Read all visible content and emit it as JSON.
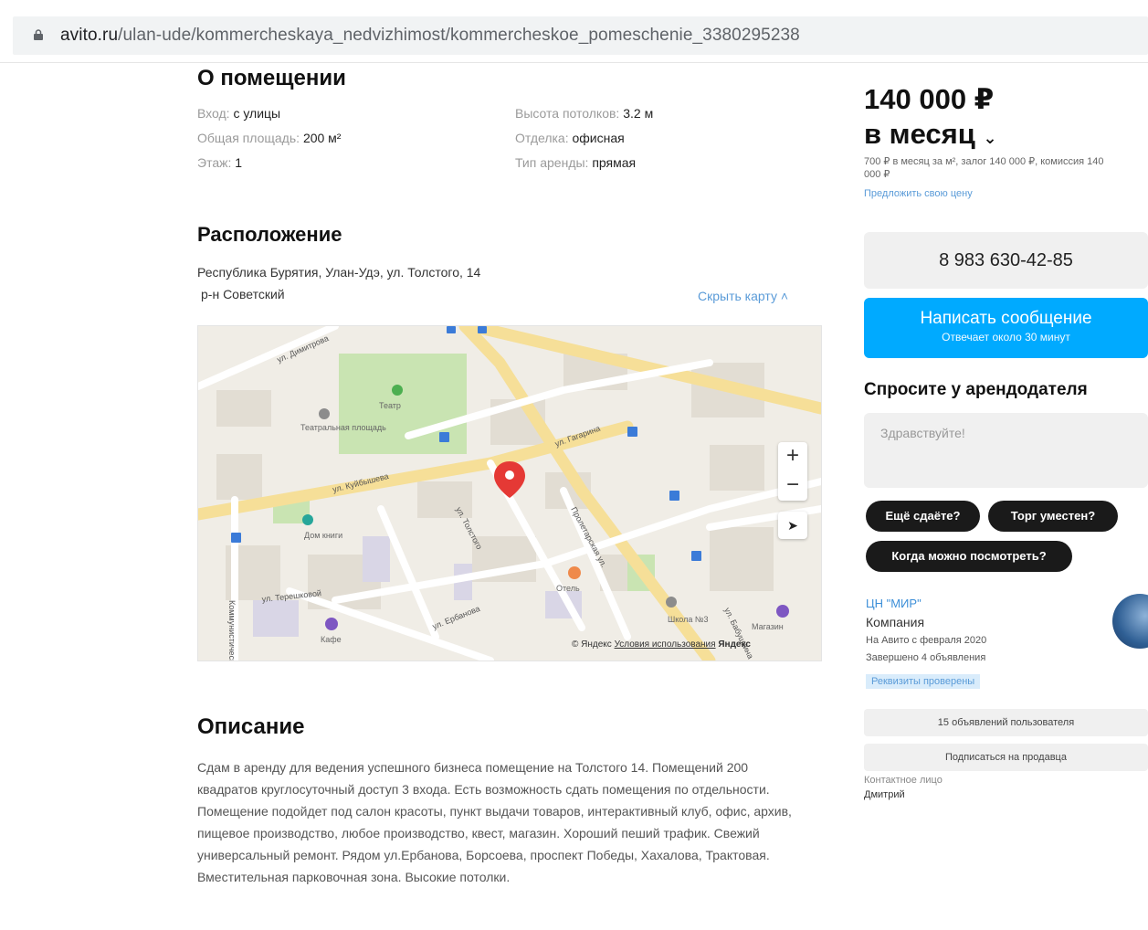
{
  "browser": {
    "url_host": "avito.ru",
    "url_path": "/ulan-ude/kommercheskaya_nedvizhimost/kommercheskoe_pomeschenie_3380295238"
  },
  "about": {
    "title": "О помещении",
    "props": [
      {
        "label": "Вход:",
        "value": "с улицы"
      },
      {
        "label": "Общая площадь:",
        "value": "200 м²"
      },
      {
        "label": "Этаж:",
        "value": "1"
      },
      {
        "label": "Высота потолков:",
        "value": "3.2 м"
      },
      {
        "label": "Отделка:",
        "value": "офисная"
      },
      {
        "label": "Тип аренды:",
        "value": "прямая"
      }
    ]
  },
  "location": {
    "title": "Расположение",
    "address": "Республика Бурятия, Улан-Удэ, ул. Толстого, 14",
    "district": "р-н Советский",
    "hide_map": "Скрыть карту",
    "map": {
      "streets": [
        "ул. Димитрова",
        "ул. Куйбышева",
        "ул. Толстого",
        "ул. Гагарина",
        "Пролетарская ул.",
        "ул. Ербанова",
        "ул. Терешковой",
        "Коммунистическая ул.",
        "ул. Бабушкина"
      ],
      "pois": [
        "Театр",
        "Театральная площадь",
        "Дом книги",
        "Отель",
        "Школа №3",
        "Магазин",
        "Кафе"
      ],
      "footer_brand": "© Яндекс",
      "footer_terms": "Условия использования",
      "footer_logo": "Яндекс",
      "zoom_in": "+",
      "zoom_out": "−",
      "locate": "➤"
    }
  },
  "description": {
    "title": "Описание",
    "text": "Сдам в аренду для ведения успешного бизнеса помещение на Толстого 14. Помещений 200 квадратов круглосуточный доступ 3 входа. Есть возможность сдать помещения по отдельности. Помещение подойдет под салон красоты, пункт выдачи товаров, интерактивный клуб, офис, архив, пищевое производство, любое производство, квест, магазин. Хороший пеший трафик. Свежий универсальный ремонт. Рядом ул.Ербанова, Борсоева, проспект Победы, Хахалова, Трактовая. Вместительная парковочная зона. Высокие потолки."
  },
  "sidebar": {
    "price": "140 000 ₽",
    "period": "в месяц",
    "price_note": "700 ₽ в месяц за м², залог 140 000 ₽, комиссия 140 000 ₽",
    "propose_link": "Предложить свою цену",
    "phone": "8 983 630-42-85",
    "message_btn": "Написать сообщение",
    "message_sub": "Отвечает около 30 минут",
    "ask_title": "Спросите у арендодателя",
    "ask_placeholder": "Здравствуйте!",
    "chips": [
      "Ещё сдаёте?",
      "Торг уместен?",
      "Когда можно посмотреть?"
    ],
    "seller": {
      "name": "ЦН \"МИР\"",
      "type": "Компания",
      "since": "На Авито с февраля 2020",
      "ads": "Завершено 4 объявления",
      "verified": "Реквизиты проверены"
    },
    "other_ads": "15 объявлений пользователя",
    "subscribe": "Подписаться на продавца",
    "contact_label": "Контактное лицо",
    "contact_name": "Дмитрий"
  },
  "colors": {
    "accent": "#00aaff",
    "link": "#5a9bd8",
    "pin": "#e53935"
  }
}
